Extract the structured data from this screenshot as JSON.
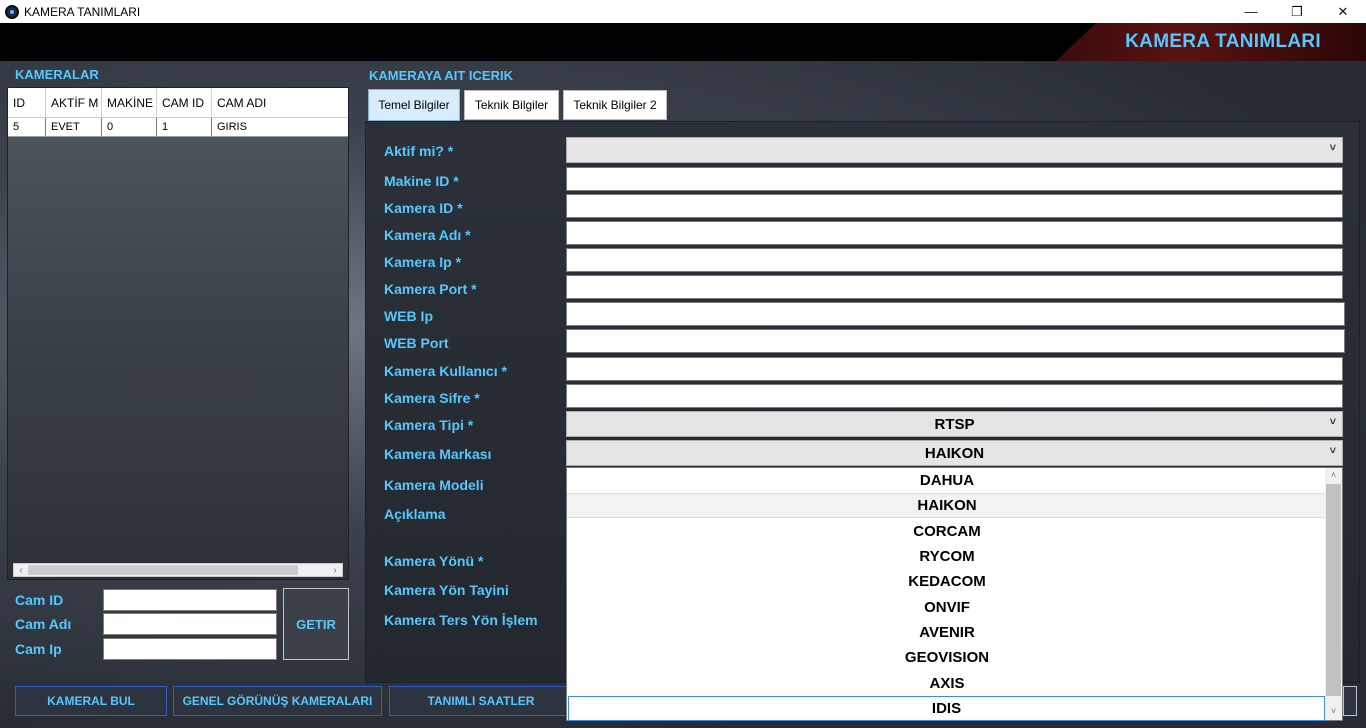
{
  "window": {
    "title": "KAMERA TANIMLARI",
    "controls": {
      "minimize": "—",
      "restore": "❐",
      "close": "✕"
    }
  },
  "header": {
    "title": "KAMERA TANIMLARI"
  },
  "left": {
    "section_title": "KAMERALAR",
    "grid": {
      "columns": [
        "ID",
        "AKTİF M",
        "MAKİNE",
        "CAM ID",
        "CAM ADI"
      ],
      "rows": [
        [
          "5",
          "EVET",
          "0",
          "1",
          "GIRIS"
        ]
      ]
    },
    "search": {
      "cam_id_label": "Cam ID",
      "cam_adi_label": "Cam Adı",
      "cam_ip_label": "Cam Ip",
      "getir_button": "GETIR"
    }
  },
  "bottom_buttons": [
    "KAMERAL BUL",
    "GENEL GÖRÜNÜŞ KAMERALARI",
    "TANIMLI SAATLER"
  ],
  "right": {
    "section_title": "KAMERAYA AIT ICERIK",
    "tabs": [
      "Temel Bilgiler",
      "Teknik Bilgiler",
      "Teknik Bilgiler 2"
    ],
    "fields": {
      "aktif_mi": "Aktif mi? *",
      "makine_id": "Makine ID *",
      "kamera_id": "Kamera ID *",
      "kamera_adi": "Kamera Adı *",
      "kamera_ip": "Kamera Ip *",
      "kamera_port": "Kamera Port *",
      "web_ip": "WEB Ip",
      "web_port": "WEB Port",
      "kamera_kullanici": "Kamera Kullanıcı *",
      "kamera_sifre": "Kamera Sifre *",
      "kamera_tipi": "Kamera Tipi *",
      "kamera_markasi": "Kamera Markası",
      "kamera_modeli": "Kamera Modeli",
      "aciklama": "Açıklama",
      "kamera_yonu": "Kamera Yönü *",
      "kamera_yon_tayini": "Kamera Yön Tayini",
      "kamera_ters_yon": "Kamera Ters Yön İşlem"
    },
    "values": {
      "aktif_mi": "",
      "kamera_tipi": "RTSP",
      "kamera_markasi": "HAIKON"
    },
    "marka_options": [
      "DAHUA",
      "HAIKON",
      "CORCAM",
      "RYCOM",
      "KEDACOM",
      "ONVIF",
      "AVENIR",
      "GEOVISION",
      "AXIS",
      "IDIS"
    ],
    "marka_selected": "HAIKON"
  }
}
